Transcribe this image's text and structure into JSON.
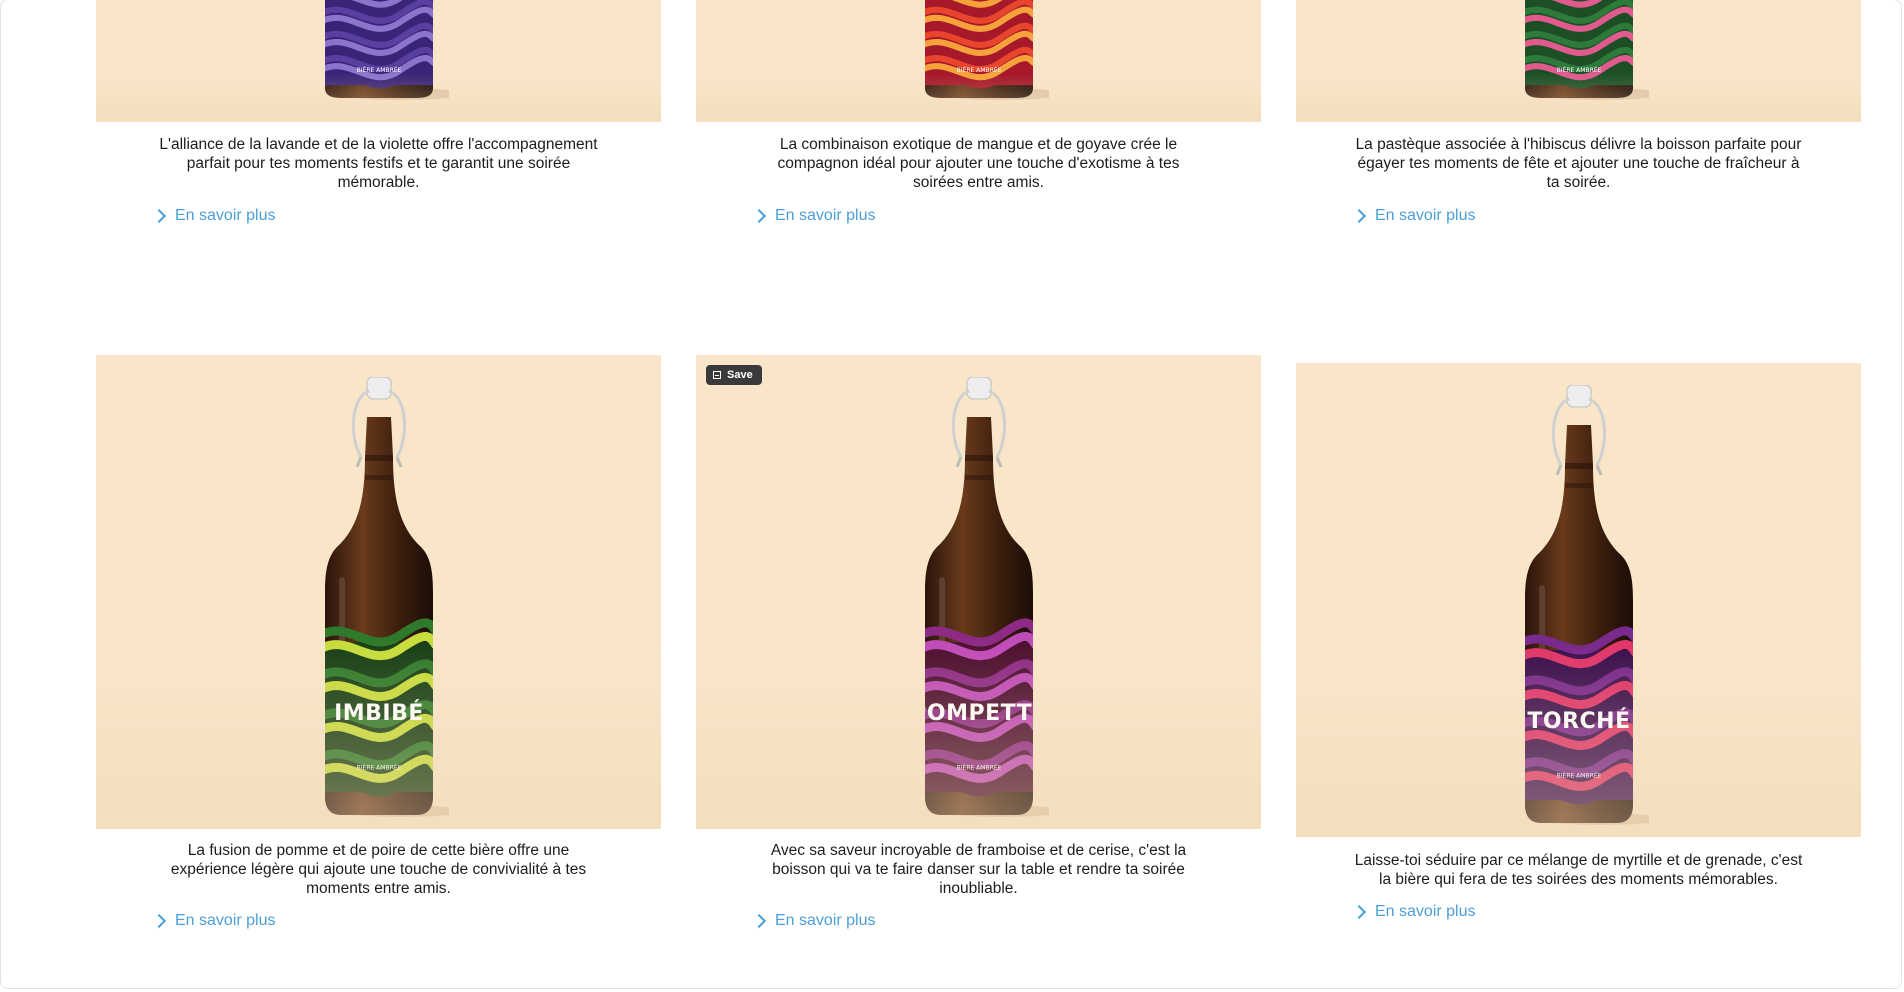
{
  "top_row": [
    {
      "desc": "L'alliance de la lavande et de la violette offre l'accompagnement parfait pour tes moments festifs et te garantit une soirée mémorable.",
      "link": "En savoir plus",
      "label_small": "BIÈRE AMBRÉE",
      "colors": {
        "c1": "#5b3fa0",
        "c2": "#8c74cc",
        "c3": "#3a2478"
      }
    },
    {
      "desc": "La combinaison exotique de mangue et de goyave crée le compagnon idéal pour ajouter une touche d'exotisme à tes soirées entre amis.",
      "link": "En savoir plus",
      "label_small": "BIÈRE AMBRÉE",
      "colors": {
        "c1": "#e8452c",
        "c2": "#f6a23a",
        "c3": "#a6182a"
      }
    },
    {
      "desc": "La pastèque associée à l'hibiscus délivre la boisson parfaite pour égayer tes moments de fête et ajouter une touche de fraîcheur à ta soirée.",
      "link": "En savoir plus",
      "label_small": "BIÈRE AMBRÉE",
      "colors": {
        "c1": "#2e7a3b",
        "c2": "#e05a8e",
        "c3": "#1c4f26"
      }
    }
  ],
  "bottom_row": [
    {
      "name": "IMBIBÉ",
      "label_small": "BIÈRE AMBRÉE",
      "desc": "La fusion de pomme et de poire de cette bière offre une expérience légère qui ajoute une touche de convivialité à tes moments entre amis.",
      "link": "En savoir plus",
      "colors": {
        "c1": "#2f7a2a",
        "c2": "#c8dc3c",
        "c3": "#183f16"
      }
    },
    {
      "name": "POMPETTE",
      "label_small": "BIÈRE AMBRÉE",
      "desc": "Avec sa saveur incroyable de framboise et de cerise, c'est la boisson qui va te faire danser sur la table et rendre ta soirée inoubliable.",
      "link": "En savoir plus",
      "colors": {
        "c1": "#8e2a86",
        "c2": "#c04bb8",
        "c3": "#4c1030"
      }
    },
    {
      "name": "TORCHÉ",
      "label_small": "BIÈRE AMBRÉE",
      "desc": "Laisse-toi séduire par ce mélange de myrtille et de grenade, c'est la bière qui fera de tes soirées des moments mémorables.",
      "link": "En savoir plus",
      "colors": {
        "c1": "#7a2a8c",
        "c2": "#e0376a",
        "c3": "#3e1250"
      }
    }
  ],
  "save_button": {
    "label": "Save",
    "icon": "image-save-icon"
  }
}
